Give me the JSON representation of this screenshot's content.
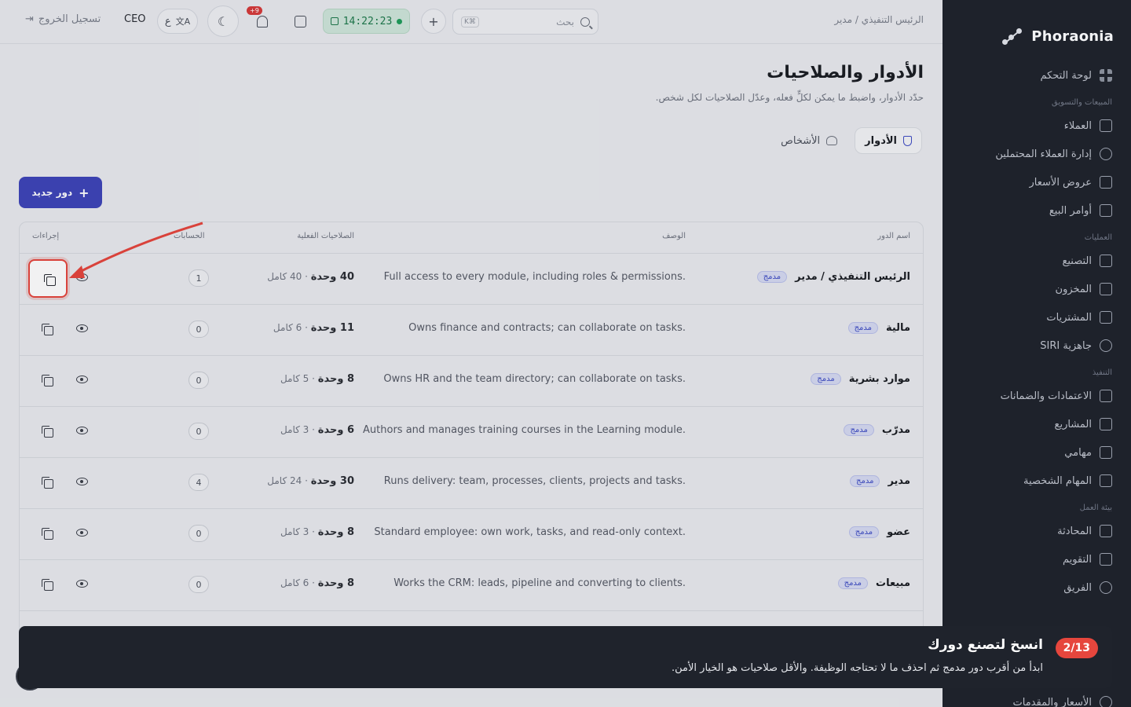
{
  "sidebar": {
    "brand": "Phoraonia",
    "items": [
      {
        "label": "لوحة التحكم",
        "icon": "dashboard-icon"
      },
      {
        "section": "المبيعات والتسويق"
      },
      {
        "label": "العملاء",
        "icon": "customers-icon"
      },
      {
        "label": "إدارة العملاء المحتملين",
        "icon": "target-icon"
      },
      {
        "label": "عروض الأسعار",
        "icon": "document-icon"
      },
      {
        "label": "أوامر البيع",
        "icon": "clipboard-icon"
      },
      {
        "section": "العمليات"
      },
      {
        "label": "التصنيع",
        "icon": "factory-icon"
      },
      {
        "label": "المخزون",
        "icon": "warehouse-icon"
      },
      {
        "label": "المشتريات",
        "icon": "cart-icon"
      },
      {
        "label": "جاهزية SIRI",
        "icon": "gauge-icon"
      },
      {
        "section": "التنفيذ"
      },
      {
        "label": "الاعتمادات والضمانات",
        "icon": "certificate-icon"
      },
      {
        "label": "المشاريع",
        "icon": "chart-icon"
      },
      {
        "label": "مهامي",
        "icon": "checklist-icon"
      },
      {
        "label": "المهام الشخصية",
        "icon": "clipboard-icon"
      },
      {
        "section": "بيئة العمل"
      },
      {
        "label": "المحادثة",
        "icon": "chat-icon"
      },
      {
        "label": "التقويم",
        "icon": "calendar-icon"
      },
      {
        "label": "الفريق",
        "icon": "team-icon"
      }
    ],
    "footer_item": "الأسعار والمقدمات"
  },
  "topbar": {
    "breadcrumb": "الرئيس التنفيذي / مدير",
    "search_placeholder": "بحث",
    "search_kbd": "K⌘",
    "clock": "14:22:23",
    "notifications_badge": "+9",
    "lang_label": "ع",
    "user_role": "CEO",
    "logout": "تسجيل الخروج"
  },
  "page": {
    "title": "الأدوار والصلاحيات",
    "subtitle": "حدّد الأدوار، واضبط ما يمكن لكلٍّ فعله، وعدّل الصلاحيات لكل شخص.",
    "tabs": [
      {
        "label": "الأدوار",
        "active": true
      },
      {
        "label": "الأشخاص",
        "active": false
      }
    ],
    "new_role_button": "دور جديد"
  },
  "table": {
    "headers": {
      "name": "اسم الدور",
      "desc": "الوصف",
      "perms": "الصلاحيات الفعلية",
      "accounts": "الحسابات",
      "actions": "إجراءات"
    },
    "rows": [
      {
        "name": "الرئيس التنفيذي / مدير",
        "badge": "مدمج",
        "desc": "Full access to every module, including roles & permissions.",
        "units": "40 وحدة",
        "full": "· 40 كامل",
        "accounts": "1"
      },
      {
        "name": "مالية",
        "badge": "مدمج",
        "desc": "Owns finance and contracts; can collaborate on tasks.",
        "units": "11 وحدة",
        "full": "· 6 كامل",
        "accounts": "0"
      },
      {
        "name": "موارد بشرية",
        "badge": "مدمج",
        "desc": "Owns HR and the team directory; can collaborate on tasks.",
        "units": "8 وحدة",
        "full": "· 5 كامل",
        "accounts": "0"
      },
      {
        "name": "مدرّب",
        "badge": "مدمج",
        "desc": "Authors and manages training courses in the Learning module.",
        "units": "6 وحدة",
        "full": "· 3 كامل",
        "accounts": "0"
      },
      {
        "name": "مدير",
        "badge": "مدمج",
        "desc": "Runs delivery: team, processes, clients, projects and tasks.",
        "units": "30 وحدة",
        "full": "· 24 كامل",
        "accounts": "4"
      },
      {
        "name": "عضو",
        "badge": "مدمج",
        "desc": "Standard employee: own work, tasks, and read-only context.",
        "units": "8 وحدة",
        "full": "· 3 كامل",
        "accounts": "0"
      },
      {
        "name": "مبيعات",
        "badge": "مدمج",
        "desc": "Works the CRM: leads, pipeline and converting to clients.",
        "units": "8 وحدة",
        "full": "· 6 كامل",
        "accounts": "0"
      }
    ]
  },
  "tour": {
    "step": "2/13",
    "title": "انسخ لتصنع دورك",
    "body": "ابدأ من أقرب دور مدمج ثم احذف ما لا تحتاجه الوظيفة. والأقل صلاحيات هو الخيار الأمن."
  },
  "colors": {
    "accent": "#3e45b8",
    "highlight": "#e6463d",
    "clock_green": "#1e7a4c",
    "sidebar_bg": "#1e222b"
  }
}
